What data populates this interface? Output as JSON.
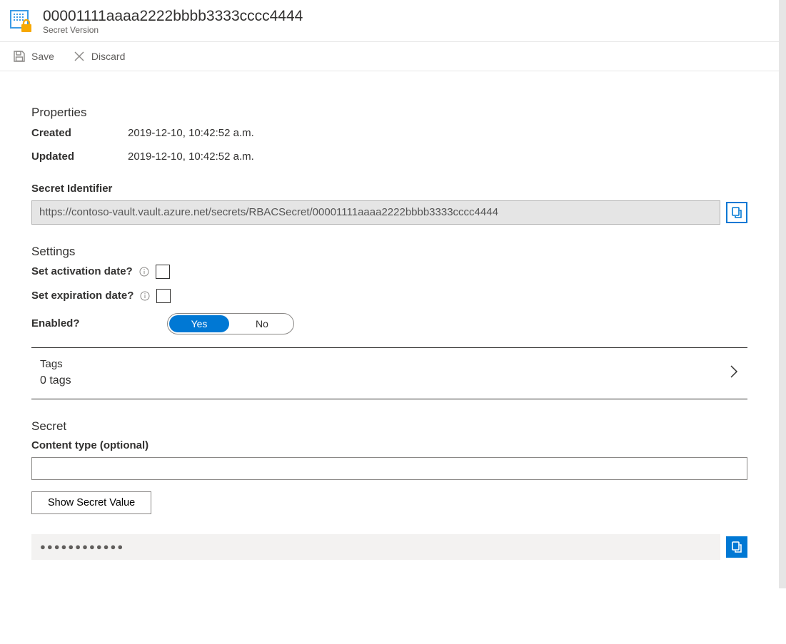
{
  "header": {
    "title": "00001111aaaa2222bbbb3333cccc4444",
    "subtitle": "Secret Version"
  },
  "toolbar": {
    "save_label": "Save",
    "discard_label": "Discard"
  },
  "properties": {
    "heading": "Properties",
    "created_label": "Created",
    "created_value": "2019-12-10, 10:42:52 a.m.",
    "updated_label": "Updated",
    "updated_value": "2019-12-10, 10:42:52 a.m."
  },
  "secret_identifier": {
    "label": "Secret Identifier",
    "value": "https://contoso-vault.vault.azure.net/secrets/RBACSecret/00001111aaaa2222bbbb3333cccc4444"
  },
  "settings": {
    "heading": "Settings",
    "activation_label": "Set activation date?",
    "activation_checked": false,
    "expiration_label": "Set expiration date?",
    "expiration_checked": false,
    "enabled_label": "Enabled?",
    "enabled_yes": "Yes",
    "enabled_no": "No",
    "enabled_value": "Yes"
  },
  "tags": {
    "label": "Tags",
    "count_text": "0 tags"
  },
  "secret": {
    "heading": "Secret",
    "content_type_label": "Content type (optional)",
    "content_type_value": "",
    "show_button": "Show Secret Value",
    "masked_value": "●●●●●●●●●●●●"
  }
}
